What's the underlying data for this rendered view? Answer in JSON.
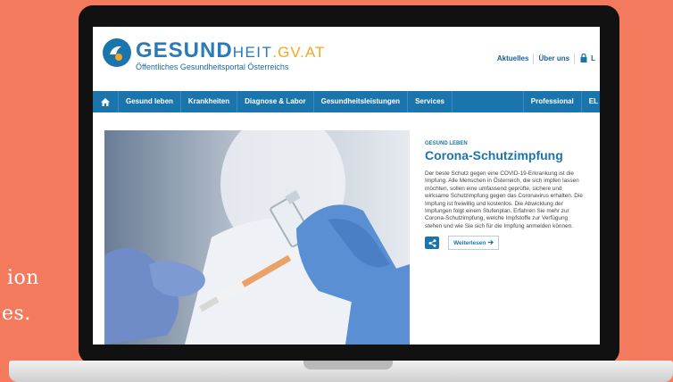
{
  "side_text": {
    "line1": "ion",
    "line2": "es."
  },
  "logo": {
    "brand_main": "GESUND",
    "brand_heit": "HEIT",
    "brand_tld": ".GV.AT",
    "subtitle": "Öffentliches Gesundheitsportal Österreichs"
  },
  "top_links": [
    {
      "label": "Aktuelles"
    },
    {
      "label": "Über uns"
    },
    {
      "label": "L"
    }
  ],
  "nav": {
    "items": [
      {
        "label": "Gesund leben"
      },
      {
        "label": "Krankheiten"
      },
      {
        "label": "Diagnose & Labor"
      },
      {
        "label": "Gesundheitsleistungen"
      },
      {
        "label": "Services"
      },
      {
        "label": "Professional"
      },
      {
        "label": "EL"
      }
    ]
  },
  "article": {
    "kicker": "GESUND LEBEN",
    "title": "Corona-Schutzimpfung",
    "body": "Der beste Schutz gegen eine COVID-19-Erkrankung ist die Impfung. Alle Menschen in Österreich, die sich impfen lassen möchten, sollen eine umfassend geprüfte, sichere und wirksame Schutzimpfung gegen das Coronavirus erhalten. Die Impfung ist freiwillig und kostenlos. Die Abwicklung der Impfungen folgt einem Stufenplan. Erfahren Sie mehr zur Corona-Schutzimpfung, welche Impfstoffe zur Verfügung stehen und wie Sie sich für die Impfung anmelden können.",
    "more_label": "Weiterlesen"
  },
  "colors": {
    "background": "#f47a5e",
    "brand_blue": "#1b75ad",
    "accent_orange": "#f5a623"
  },
  "icons": {
    "home": "home-icon",
    "lock": "lock-icon",
    "share": "share-icon",
    "arrow": "arrow-right-icon"
  }
}
